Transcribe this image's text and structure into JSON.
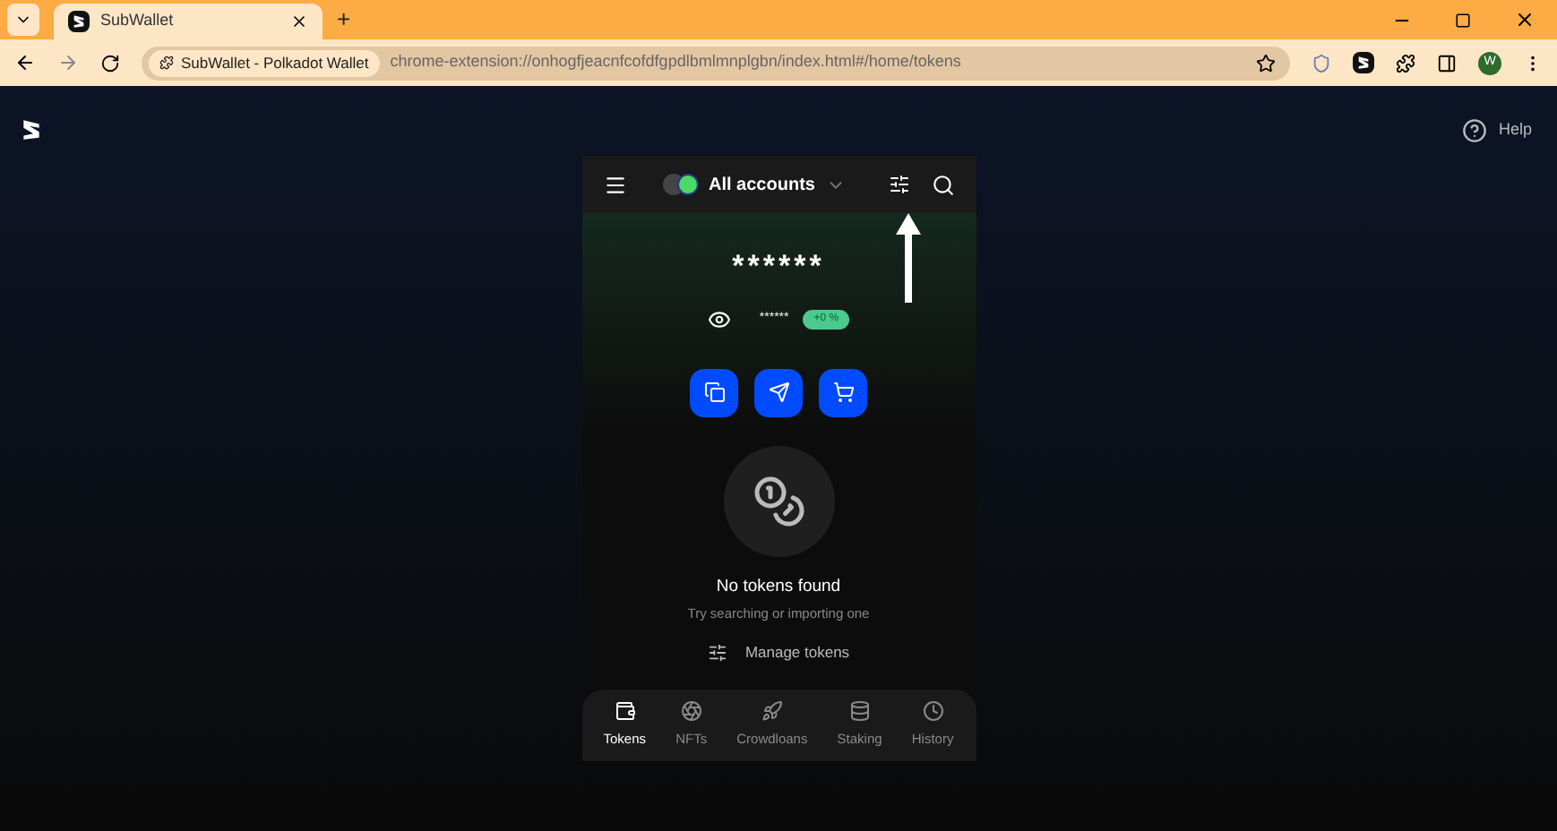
{
  "browser": {
    "tab_title": "SubWallet",
    "new_tab": "+",
    "site_chip": "SubWallet - Polkadot Wallet",
    "url": "chrome-extension://onhogfjeacnfcofdfgpdlbmlmnplgbn/index.html#/home/tokens",
    "profile_initial": "W"
  },
  "page": {
    "help": "Help"
  },
  "header": {
    "account": "All accounts"
  },
  "balance": {
    "total": "******",
    "sub": "******",
    "change": "+0 %"
  },
  "empty": {
    "title": "No tokens found",
    "subtitle": "Try searching or importing one",
    "manage": "Manage tokens"
  },
  "nav": [
    {
      "label": "Tokens",
      "kind": "wallet",
      "selected": true
    },
    {
      "label": "NFTs",
      "kind": "nft",
      "selected": false
    },
    {
      "label": "Crowdloans",
      "kind": "rocket",
      "selected": false
    },
    {
      "label": "Staking",
      "kind": "coins",
      "selected": false
    },
    {
      "label": "History",
      "kind": "clock",
      "selected": false
    }
  ]
}
